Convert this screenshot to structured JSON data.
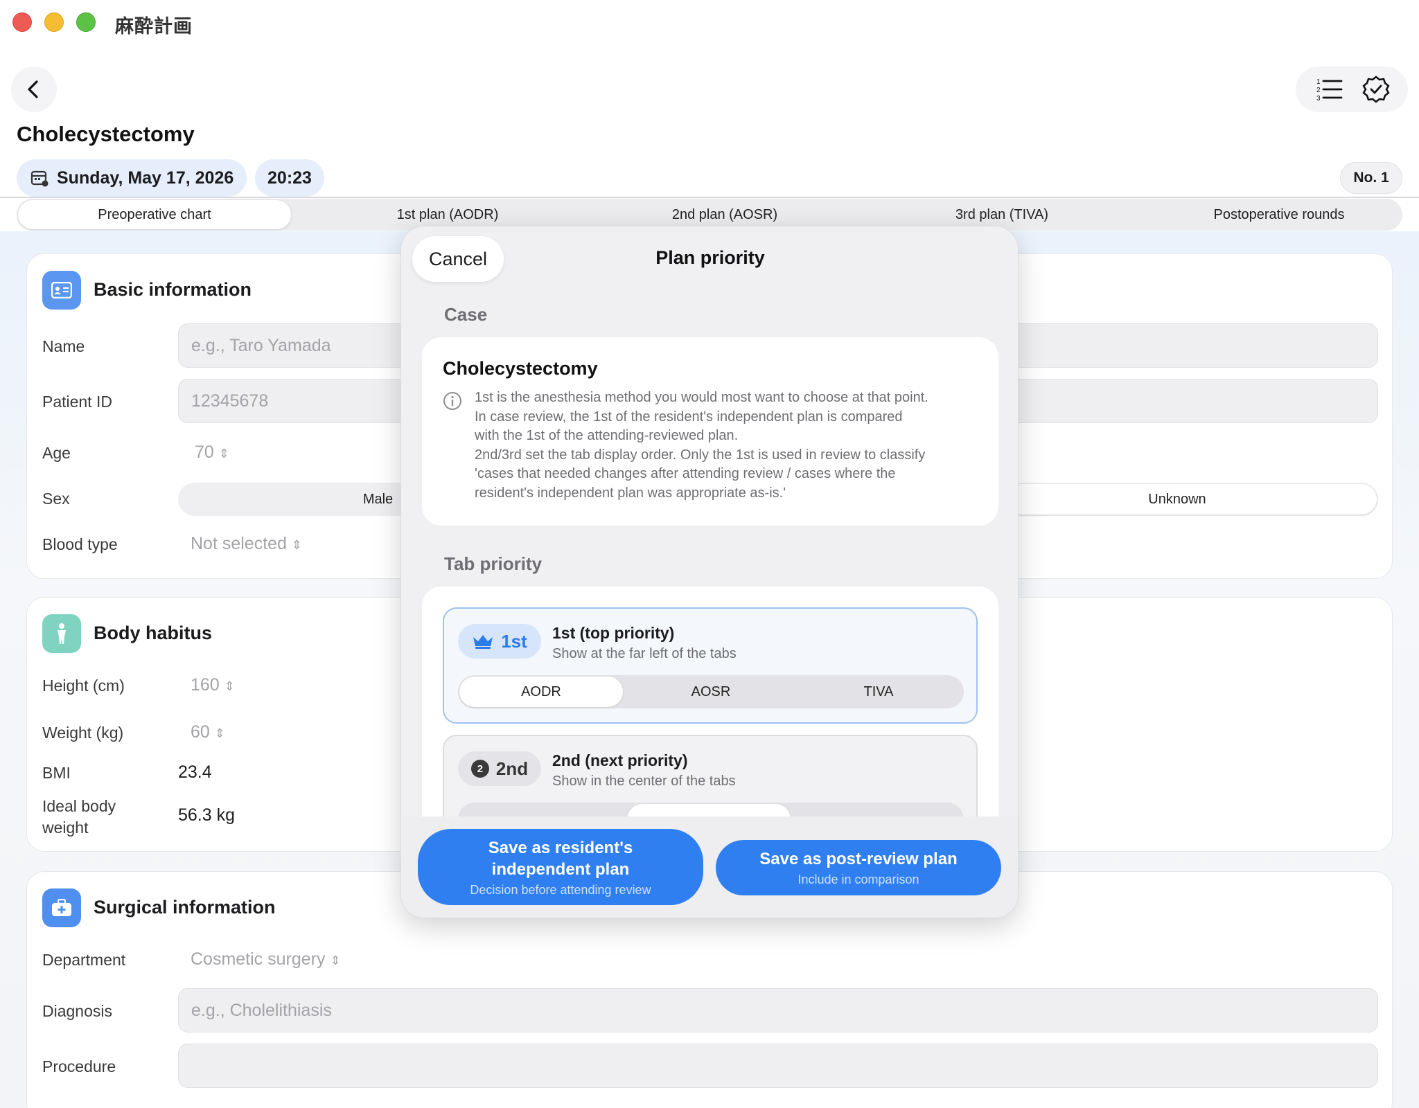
{
  "window": {
    "title": "麻酔計画"
  },
  "header": {
    "title": "Cholecystectomy",
    "date": "Sunday, May 17, 2026",
    "time": "20:23",
    "case_number": "No. 1"
  },
  "tabs": [
    {
      "label": "Preoperative chart",
      "active": true
    },
    {
      "label": "1st plan (AODR)"
    },
    {
      "label": "2nd plan (AOSR)"
    },
    {
      "label": "3rd plan (TIVA)"
    },
    {
      "label": "Postoperative rounds"
    }
  ],
  "basic_info": {
    "title": "Basic information",
    "name_label": "Name",
    "name_placeholder": "e.g., Taro Yamada",
    "patient_id_label": "Patient ID",
    "patient_id_placeholder": "12345678",
    "age_label": "Age",
    "age_value": "70",
    "sex_label": "Sex",
    "sex_options": [
      "Male",
      "Unknown"
    ],
    "blood_type_label": "Blood type",
    "blood_type_value": "Not selected"
  },
  "body_habitus": {
    "title": "Body habitus",
    "height_label": "Height (cm)",
    "height_value": "160",
    "weight_label": "Weight (kg)",
    "weight_value": "60",
    "bmi_label": "BMI",
    "bmi_value": "23.4",
    "ibw_label_1": "Ideal body",
    "ibw_label_2": "weight",
    "ibw_value": "56.3 kg"
  },
  "surgical_info": {
    "title": "Surgical information",
    "department_label": "Department",
    "department_value": "Cosmetic surgery",
    "diagnosis_label": "Diagnosis",
    "diagnosis_placeholder": "e.g., Cholelithiasis",
    "procedure_label": "Procedure"
  },
  "modal": {
    "cancel_label": "Cancel",
    "title": "Plan priority",
    "case_section": "Case",
    "case_title": "Cholecystectomy",
    "info_lines": [
      "1st is the anesthesia method you would most want to choose at that point.",
      "In case review, the 1st of the resident's independent plan is compared",
      "with the 1st of the attending-reviewed plan.",
      "2nd/3rd set the tab display order. Only the 1st is used in review to classify",
      "'cases that needed changes after attending review / cases where the",
      "resident's independent plan was appropriate as-is.'"
    ],
    "tab_priority_section": "Tab priority",
    "priorities": [
      {
        "badge": "1st",
        "title": "1st (top priority)",
        "subtitle": "Show at the far left of the tabs",
        "options": [
          "AODR",
          "AOSR",
          "TIVA"
        ],
        "selected": "AODR"
      },
      {
        "badge": "2nd",
        "badge_number": "2",
        "title": "2nd (next priority)",
        "subtitle": "Show in the center of the tabs"
      }
    ],
    "save_resident_main_1": "Save as resident's",
    "save_resident_main_2": "independent plan",
    "save_resident_sub": "Decision before attending review",
    "save_review_main": "Save as post-review plan",
    "save_review_sub": "Include in comparison"
  },
  "colors": {
    "accent": "#2f7ff0",
    "badge_bg": "#d7e5fb",
    "body_icon": "#7fd3c0",
    "card_icon": "#4f8ff0"
  },
  "icons": {
    "back": "chevron-left-icon",
    "list": "numbered-list-icon",
    "verified": "checkmark-seal-icon",
    "calendar": "calendar-icon",
    "id_card": "id-card-icon",
    "figure": "person-figure-icon",
    "briefcase": "medical-bag-icon",
    "info": "info-circle-icon",
    "crown": "crown-icon"
  }
}
